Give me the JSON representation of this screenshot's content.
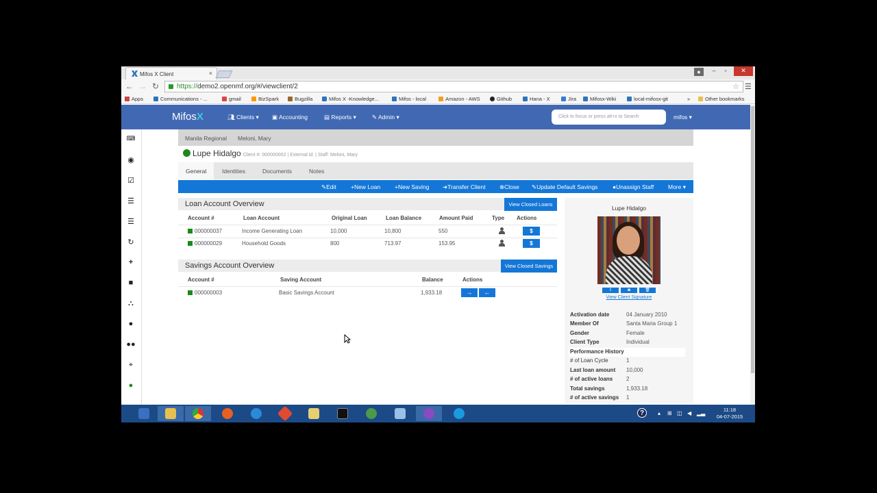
{
  "browser": {
    "tab_title": "Mifos X Client",
    "tab_close": "×",
    "url_scheme": "https://",
    "url_rest": "demo2.openmf.org/#/viewclient/2",
    "bookmarks": [
      "Apps",
      "Communications - ...",
      "gmail",
      "BizSpark",
      "Bugzilla",
      "Mifos X -Knowledge...",
      "Mifos - local",
      "Amazon - AWS",
      "Github",
      "Hana - X",
      "Jira",
      "Mifosx-Wiki",
      "local-mifosx-git",
      "»",
      "Other bookmarks"
    ]
  },
  "app": {
    "logo": "Mifos",
    "logo_x": "X",
    "nav": {
      "clients": "Clients ▾",
      "accounting": "Accounting",
      "reports": "Reports ▾",
      "admin": "Admin ▾",
      "user": "mifos ▾"
    },
    "search_placeholder": "Click to focus or press alt+x to Search"
  },
  "breadcrumb": {
    "office": "Manila Regional",
    "staff": "Meloni, Mary"
  },
  "client": {
    "name": "Lupe Hidalgo",
    "meta": "Client #: 000000002 | External id: | Staff: Meloni, Mary"
  },
  "tabs": [
    "General",
    "Identities",
    "Documents",
    "Notes"
  ],
  "actions": [
    "Edit",
    "New Loan",
    "New Saving",
    "Transfer Client",
    "Close",
    "Update Default Savings",
    "Unassign Staff",
    "More ▾"
  ],
  "loans": {
    "title": "Loan Account Overview",
    "closed_button": "View Closed Loans",
    "headers": [
      "Account #",
      "Loan Account",
      "Original Loan",
      "Loan Balance",
      "Amount Paid",
      "Type",
      "Actions"
    ],
    "rows": [
      {
        "account": "000000037",
        "name": "Income Generating Loan",
        "original": "10,000",
        "balance": "10,800",
        "paid": "550",
        "action": "$"
      },
      {
        "account": "000000029",
        "name": "Household Goods",
        "original": "800",
        "balance": "713.97",
        "paid": "153.95",
        "action": "$"
      }
    ]
  },
  "savings": {
    "title": "Savings Account Overview",
    "closed_button": "View Closed Savings",
    "headers": [
      "Account #",
      "Saving Account",
      "Balance",
      "Actions"
    ],
    "rows": [
      {
        "account": "000000003",
        "name": "Basic Savings Account",
        "balance": "1,933.18",
        "deposit": "→",
        "withdraw": "←"
      }
    ]
  },
  "profile": {
    "name": "Lupe Hidalgo",
    "signature_link": "View Client Signature",
    "details": [
      {
        "label": "Activation date",
        "value": "04 January 2010"
      },
      {
        "label": "Member Of",
        "value": "Santa Maria Group 1"
      },
      {
        "label": "Gender",
        "value": "Female"
      },
      {
        "label": "Client Type",
        "value": "Individual"
      }
    ],
    "performance_title": "Performance History",
    "performance": [
      {
        "label": "# of Loan Cycle",
        "value": "1"
      },
      {
        "label": "Last loan amount",
        "value": "10,000"
      },
      {
        "label": "# of active loans",
        "value": "2"
      },
      {
        "label": "Total savings",
        "value": "1,933.18"
      },
      {
        "label": "# of active savings",
        "value": "1"
      }
    ]
  },
  "taskbar": {
    "time": "11:18",
    "date": "04-07-2015"
  },
  "colors": {
    "nav": "#4169b3",
    "action": "#1477d7",
    "active_status": "#1a8a1a"
  }
}
